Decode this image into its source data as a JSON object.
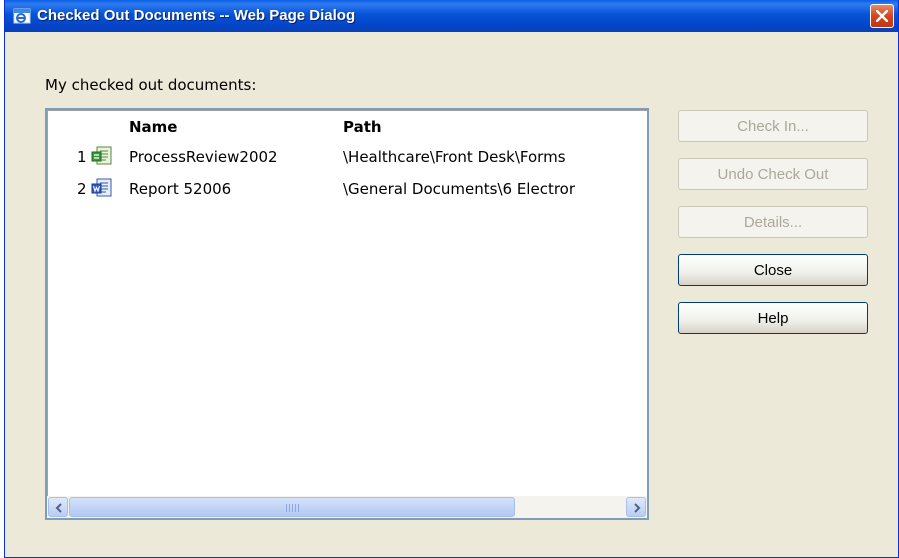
{
  "window": {
    "title": "Checked Out Documents -- Web Page Dialog",
    "title_bar_color": "#0653d8",
    "close_button_color": "#d5451e"
  },
  "dialog": {
    "caption": "My checked out documents:",
    "list": {
      "columns": {
        "name": "Name",
        "path": "Path"
      },
      "rows": [
        {
          "num": "1",
          "icon": "infopath-form-icon",
          "name": "ProcessReview2002",
          "path": "\\Healthcare\\Front Desk\\Forms"
        },
        {
          "num": "2",
          "icon": "word-document-icon",
          "name": "Report 52006",
          "path": "\\General Documents\\6 Electror"
        }
      ]
    },
    "buttons": {
      "check_in": "Check In...",
      "undo_check_out": "Undo Check Out",
      "details": "Details...",
      "close": "Close",
      "help": "Help"
    }
  }
}
